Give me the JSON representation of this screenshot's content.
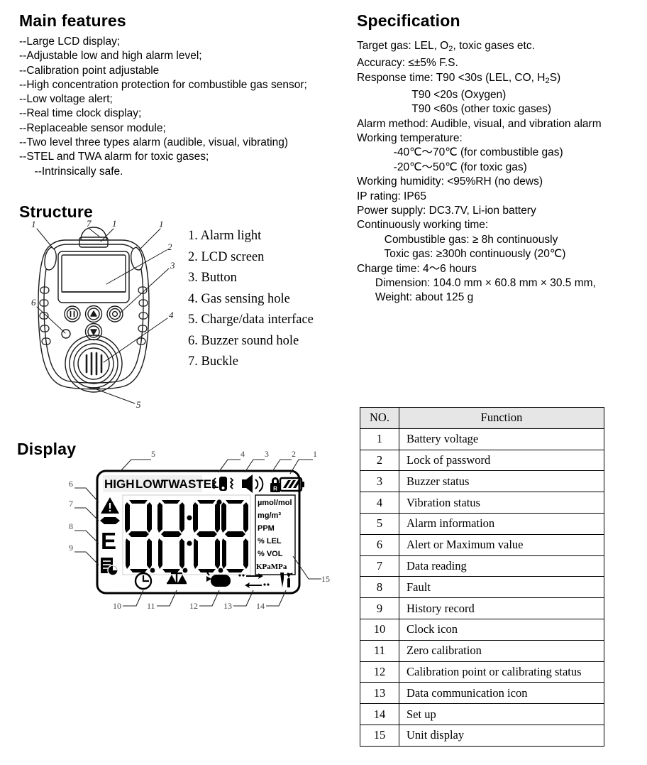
{
  "main_features": {
    "heading": "Main features",
    "items": [
      "--Large LCD display;",
      "--Adjustable low and high alarm level;",
      "--Calibration point adjustable",
      "--High concentration protection for combustible gas sensor;",
      "--Low voltage alert;",
      "--Real time clock display;",
      "--Replaceable sensor module;",
      "--Two level three types alarm (audible, visual, vibrating)",
      "--STEL and TWA alarm for toxic gases;",
      "     --Intrinsically safe."
    ]
  },
  "specification": {
    "heading": "Specification",
    "lines": [
      "Target gas: LEL, O2, toxic gases etc.",
      "Accuracy: ≤±5% F.S.",
      "Response time: T90 <30s (LEL, CO, H2S)",
      "                  T90 <20s (Oxygen)",
      "                  T90 <60s (other toxic gases)",
      "Alarm method: Audible, visual, and vibration alarm",
      "Working temperature:",
      "            -40℃～70℃ (for combustible gas)",
      "            -20℃～50℃ (for toxic gas)",
      "Working humidity: <95%RH (no dews)",
      "IP rating: IP65",
      "Power supply: DC3.7V, Li-ion battery",
      "Continuously working time:",
      "         Combustible gas: ≥ 8h continuously",
      "         Toxic gas: ≥300h continuously (20℃)",
      "Charge time: 4～6 hours",
      "      Dimension: 104.0 mm × 60.8 mm × 30.5 mm,",
      "      Weight: about 125 g"
    ],
    "target_gas_label": "Target gas: LEL, O",
    "target_gas_sub": "2",
    "target_gas_tail": ", toxic gases etc.",
    "response_label": "Response time: T90 <30s (LEL, CO, H",
    "response_sub": "2",
    "response_tail": "S)"
  },
  "structure": {
    "heading": "Structure",
    "legend": [
      "1. Alarm light",
      "2. LCD screen",
      "3. Button",
      "4. Gas sensing hole",
      "5. Charge/data interface",
      "6. Buzzer sound hole",
      "7. Buckle"
    ],
    "callouts": [
      "1",
      "1",
      "1",
      "2",
      "3",
      "4",
      "5",
      "6",
      "7"
    ]
  },
  "display": {
    "heading": "Display",
    "lcd": {
      "status_labels": [
        "HIGH",
        "LOW",
        "TWA",
        "STEL"
      ],
      "digits": "88:88",
      "units": [
        "µmol/mol",
        "mg/m³",
        "PPM",
        "% LEL",
        "% VOL",
        "KPaMPa"
      ],
      "fault_letter": "E",
      "callouts_top": [
        "5",
        "4",
        "3",
        "2",
        "1"
      ],
      "callouts_left": [
        "6",
        "7",
        "8",
        "9"
      ],
      "callouts_bottom": [
        "10",
        "11",
        "12",
        "13",
        "14"
      ],
      "callout_right": "15",
      "icons_top": [
        "vibration-icon",
        "speaker-icon",
        "lock-icon",
        "battery-icon"
      ],
      "icons_left": [
        "warning-triangle-icon",
        "dash-bar-icon",
        "fault-letter-e",
        "history-record-icon"
      ],
      "icons_bottom": [
        "clock-icon",
        "balance-scale-icon",
        "gas-cylinder-icon",
        "data-communication-icon",
        "tools-icon"
      ]
    }
  },
  "function_table": {
    "headers": [
      "NO.",
      "Function"
    ],
    "rows": [
      {
        "no": "1",
        "function": "Battery voltage"
      },
      {
        "no": "2",
        "function": "Lock of password"
      },
      {
        "no": "3",
        "function": "Buzzer status"
      },
      {
        "no": "4",
        "function": "Vibration status"
      },
      {
        "no": "5",
        "function": "Alarm information"
      },
      {
        "no": "6",
        "function": "Alert or Maximum value"
      },
      {
        "no": "7",
        "function": "Data reading"
      },
      {
        "no": "8",
        "function": "Fault"
      },
      {
        "no": "9",
        "function": "History record"
      },
      {
        "no": "10",
        "function": "Clock icon"
      },
      {
        "no": "11",
        "function": "Zero calibration"
      },
      {
        "no": "12",
        "function": "Calibration point or calibrating status"
      },
      {
        "no": "13",
        "function": "Data communication icon"
      },
      {
        "no": "14",
        "function": "Set up"
      },
      {
        "no": "15",
        "function": "Unit display"
      }
    ]
  },
  "colors": {
    "ink": "#000000",
    "table_header_bg": "#e6e6e6",
    "callout_gray": "#555555"
  }
}
